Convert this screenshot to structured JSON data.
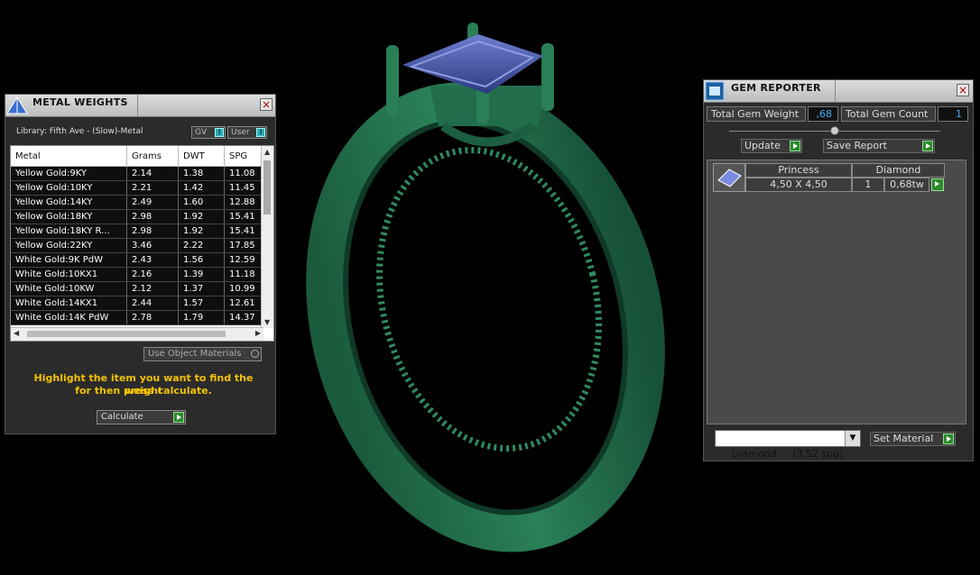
{
  "metal_weights": {
    "title": "METAL WEIGHTS",
    "close": "×",
    "library": "Library: Fifth Ave - (Slow)-Metal",
    "gv_label": "GV",
    "user_label": "User",
    "toggle_mark": "I",
    "columns": [
      "Metal",
      "Grams",
      "DWT",
      "SPG"
    ],
    "rows": [
      [
        "Yellow Gold:9KY",
        "2.14",
        "1.38",
        "11.08"
      ],
      [
        "Yellow Gold:10KY",
        "2.21",
        "1.42",
        "11.45"
      ],
      [
        "Yellow Gold:14KY",
        "2.49",
        "1.60",
        "12.88"
      ],
      [
        "Yellow Gold:18KY",
        "2.98",
        "1.92",
        "15.41"
      ],
      [
        "Yellow Gold:18KY R...",
        "2.98",
        "1.92",
        "15.41"
      ],
      [
        "Yellow Gold:22KY",
        "3.46",
        "2.22",
        "17.85"
      ],
      [
        "White Gold:9K PdW",
        "2.43",
        "1.56",
        "12.59"
      ],
      [
        "White Gold:10KX1",
        "2.16",
        "1.39",
        "11.18"
      ],
      [
        "White Gold:10KW",
        "2.12",
        "1.37",
        "10.99"
      ],
      [
        "White Gold:14KX1",
        "2.44",
        "1.57",
        "12.61"
      ],
      [
        "White Gold:14K PdW",
        "2.78",
        "1.79",
        "14.37"
      ]
    ],
    "use_object_materials": "Use Object Materials",
    "message_line1": "Highlight the item you want to find the weight",
    "message_line2": "for then press calculate.",
    "calculate": "Calculate"
  },
  "gem_reporter": {
    "title": "GEM REPORTER",
    "close": "×",
    "total_weight_label": "Total Gem Weight",
    "total_weight_value": ",68",
    "total_count_label": "Total Gem Count",
    "total_count_value": "1",
    "update": "Update",
    "save_report": "Save Report",
    "gem": {
      "cut": "Princess",
      "material": "Diamond",
      "size": "4,50 X 4,50",
      "count": "1",
      "weight": "0,68tw"
    },
    "material_select": "Diamond     (3,52 spg)",
    "set_material": "Set Material"
  },
  "colors": {
    "ring_green": "#1f6b4a",
    "stone_blue": "#3b4f9a",
    "accent_cyan": "#3fb0ff",
    "message_yellow": "#f2c200"
  }
}
